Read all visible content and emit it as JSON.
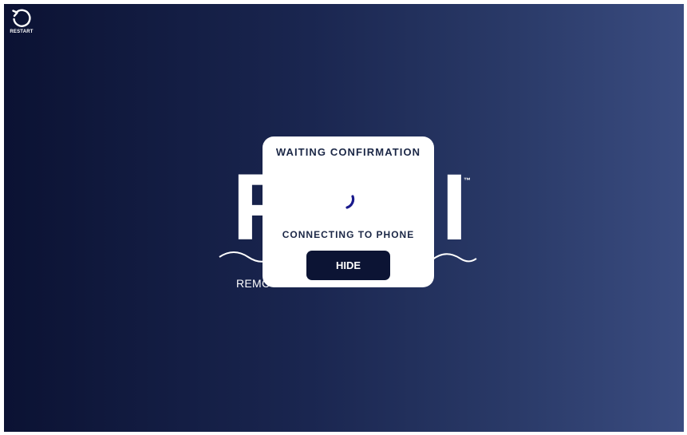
{
  "restart": {
    "label": "RESTART",
    "icon": "restart-icon"
  },
  "logo": {
    "left_letter": "F",
    "right_letter": "I",
    "trademark": "™",
    "tagline": "REMC"
  },
  "modal": {
    "title": "WAITING CONFIRMATION",
    "status": "CONNECTING TO PHONE",
    "hide_label": "HIDE",
    "spinner_icon": "loading-spinner-icon"
  },
  "colors": {
    "background_start": "#0b1233",
    "background_end": "#3a4c80",
    "modal_text": "#1b2746",
    "button_bg": "#0c1434",
    "spinner": "#1a1a8c"
  }
}
